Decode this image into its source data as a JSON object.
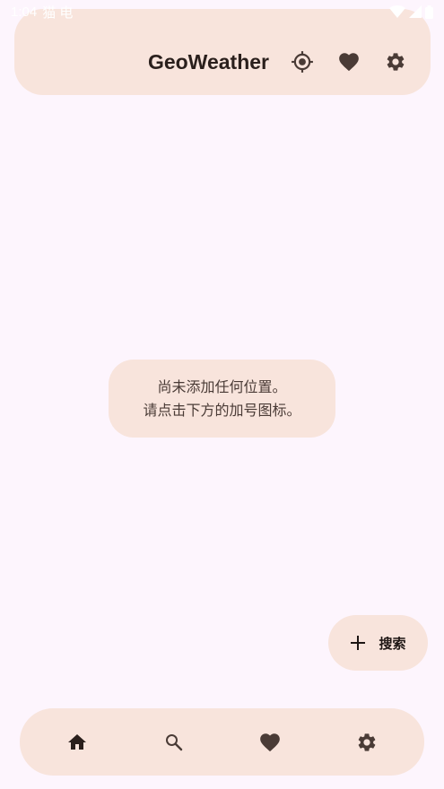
{
  "status_bar": {
    "time": "1:04",
    "extra": "猫 电"
  },
  "app": {
    "title": "GeoWeather"
  },
  "toolbar": {
    "icons": [
      "my-location-icon",
      "heart-icon",
      "gear-icon"
    ]
  },
  "empty_state": {
    "line1": "尚未添加任何位置。",
    "line2": "请点击下方的加号图标。"
  },
  "fab": {
    "label": "搜索",
    "icon": "plus-icon"
  },
  "bottom_nav": {
    "items": [
      "home-icon",
      "search-icon",
      "heart-icon",
      "gear-icon"
    ]
  },
  "colors": {
    "background": "#fdf5fd",
    "surface": "#f8e4dc",
    "icon": "#4a3b36"
  }
}
